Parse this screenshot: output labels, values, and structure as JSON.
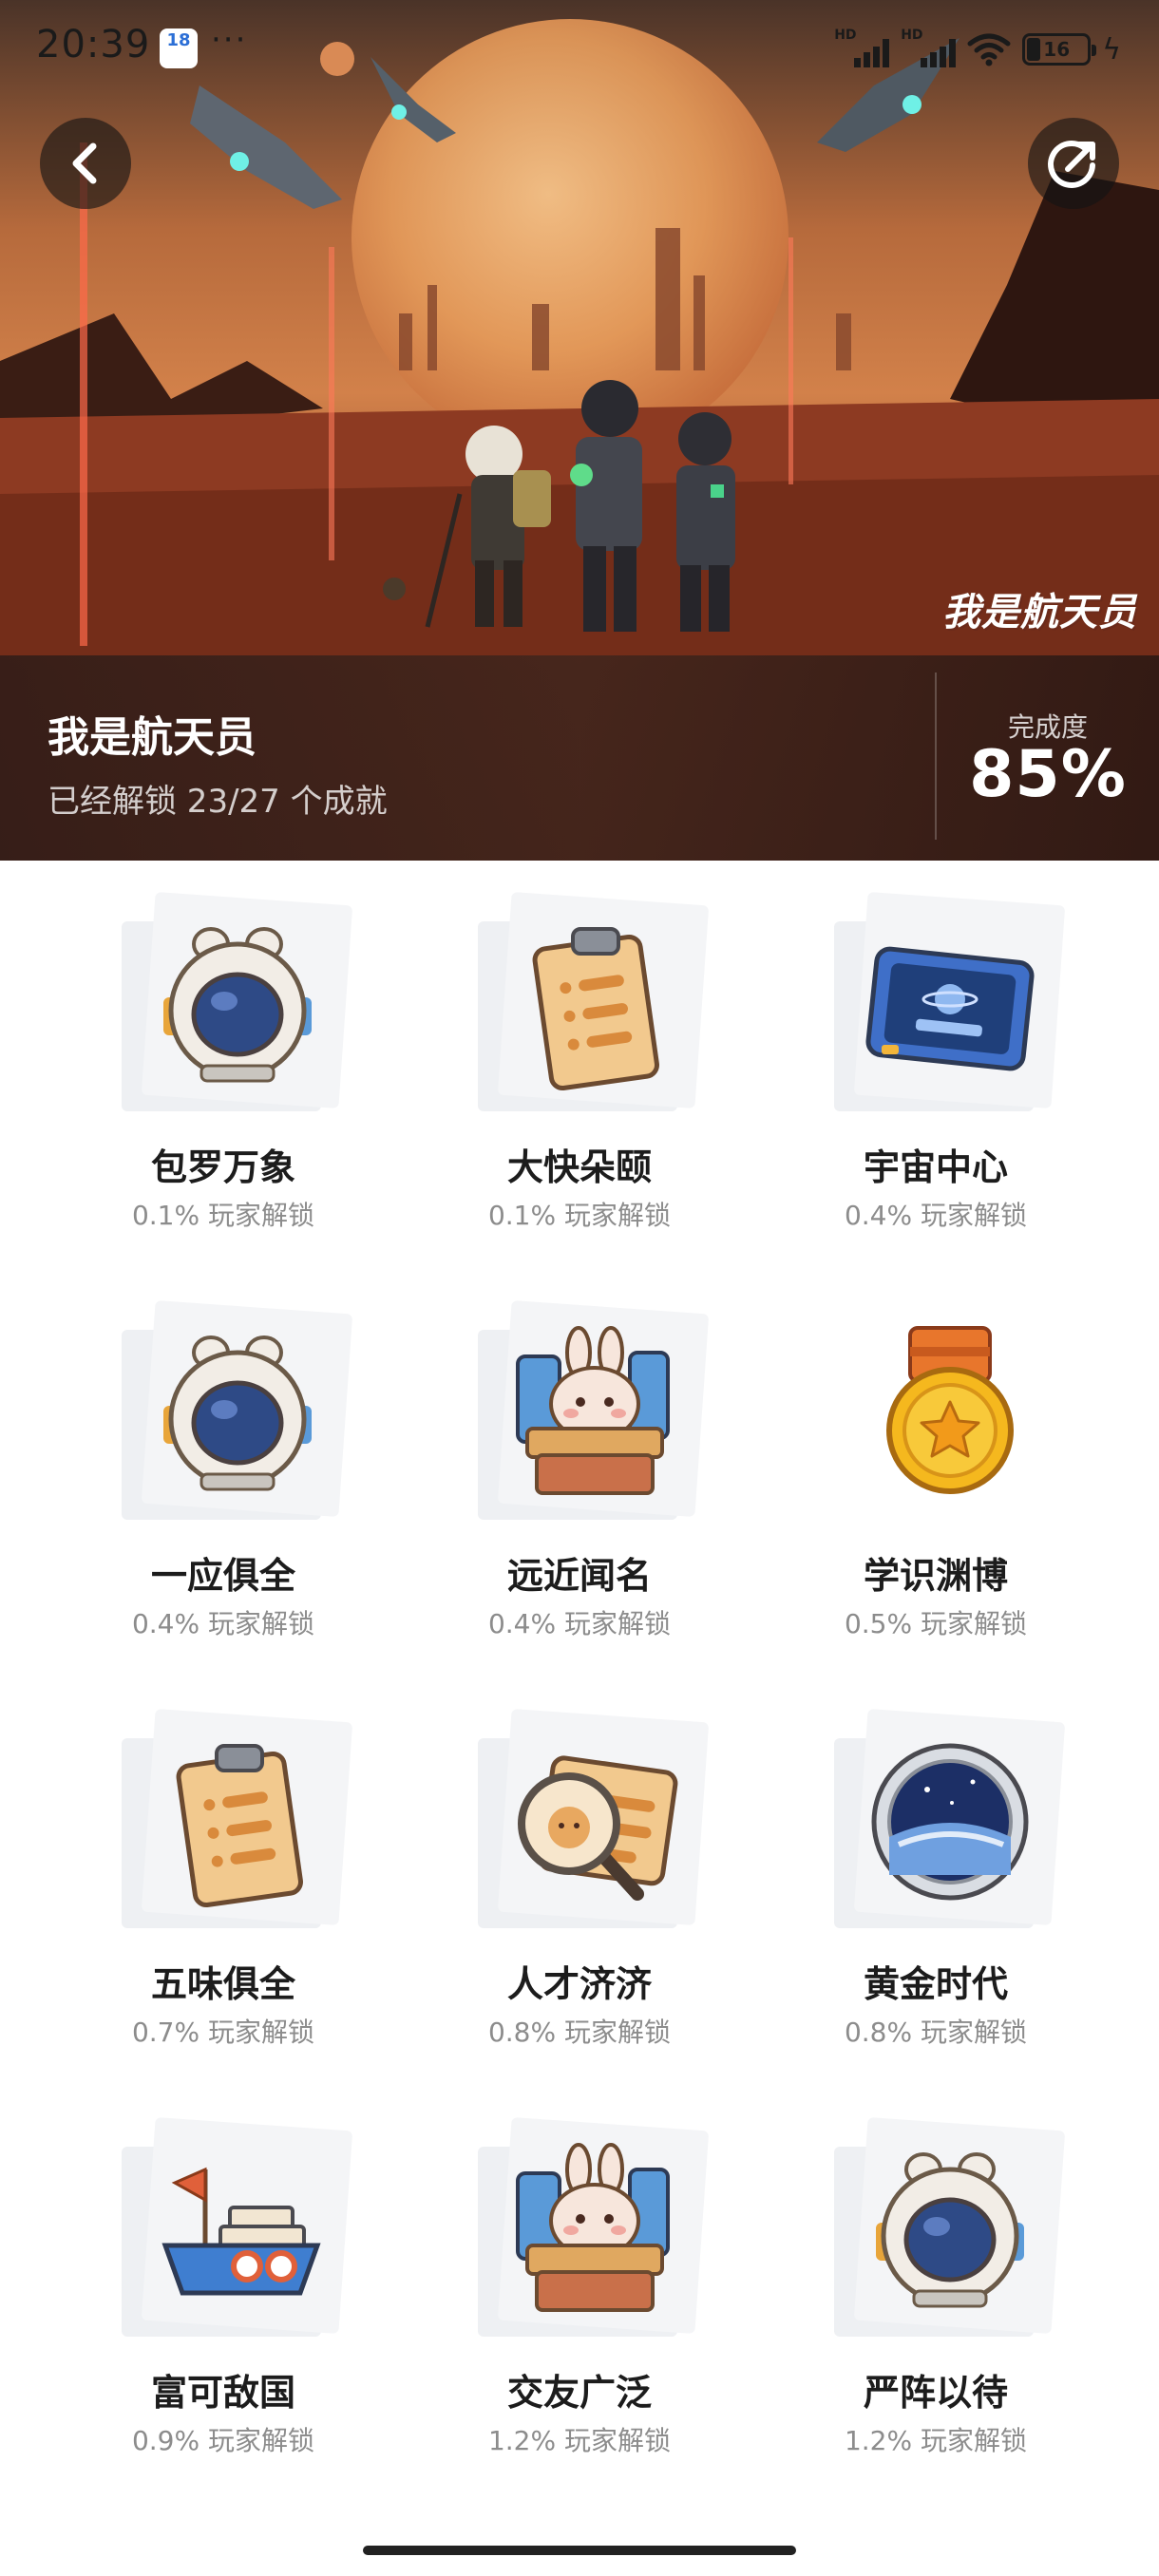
{
  "status_bar": {
    "time": "20:39",
    "calendar_day": "18",
    "more": "···",
    "signal_1_label": "HD",
    "signal_2_label": "HD",
    "battery_level": "16"
  },
  "hero": {
    "title": "我是航天员",
    "unlock_text": "已经解锁 23/27 个成就",
    "progress_label": "完成度",
    "progress_value": "85%",
    "logo_text": "我是航天员"
  },
  "achievements": [
    {
      "name": "包罗万象",
      "rate": "0.1% 玩家解锁",
      "icon": "helmet-icon"
    },
    {
      "name": "大快朵颐",
      "rate": "0.1% 玩家解锁",
      "icon": "clipboard-icon"
    },
    {
      "name": "宇宙中心",
      "rate": "0.4% 玩家解锁",
      "icon": "tablet-icon"
    },
    {
      "name": "一应俱全",
      "rate": "0.4% 玩家解锁",
      "icon": "helmet-icon"
    },
    {
      "name": "远近闻名",
      "rate": "0.4% 玩家解锁",
      "icon": "bunny-box-icon"
    },
    {
      "name": "学识渊博",
      "rate": "0.5% 玩家解锁",
      "icon": "gold-medal-icon"
    },
    {
      "name": "五味俱全",
      "rate": "0.7% 玩家解锁",
      "icon": "clipboard-icon"
    },
    {
      "name": "人才济济",
      "rate": "0.8% 玩家解锁",
      "icon": "magnifier-card-icon"
    },
    {
      "name": "黄金时代",
      "rate": "0.8% 玩家解锁",
      "icon": "porthole-earth-icon"
    },
    {
      "name": "富可敌国",
      "rate": "0.9% 玩家解锁",
      "icon": "ship-icon"
    },
    {
      "name": "交友广泛",
      "rate": "1.2% 玩家解锁",
      "icon": "bunny-box-icon"
    },
    {
      "name": "严阵以待",
      "rate": "1.2% 玩家解锁",
      "icon": "helmet-icon"
    }
  ]
}
